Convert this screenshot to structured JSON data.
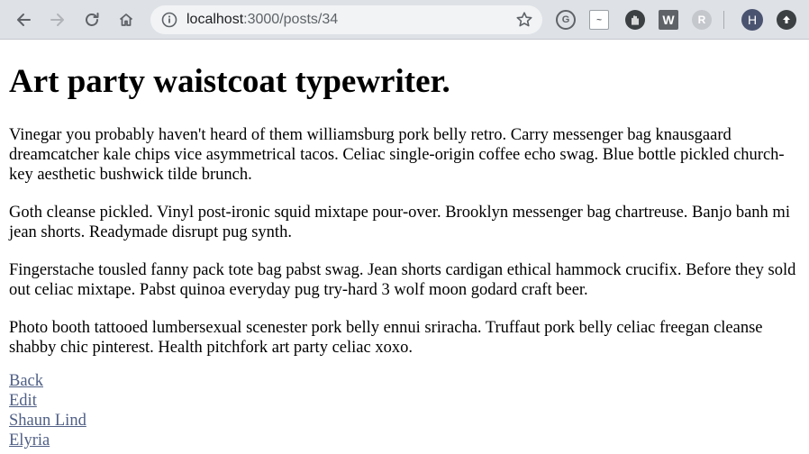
{
  "browser": {
    "url_host": "localhost",
    "url_port_path": ":3000/posts/34",
    "avatar_letter": "H",
    "ext_w_label": "W",
    "ext_r_label": "R",
    "ext_g_label": "G",
    "ext_box_label": "~"
  },
  "post": {
    "title": "Art party waistcoat typewriter.",
    "paragraphs": [
      "Vinegar you probably haven't heard of them williamsburg pork belly retro. Carry messenger bag knausgaard dreamcatcher kale chips vice asymmetrical tacos. Celiac single-origin coffee echo swag. Blue bottle pickled church-key aesthetic bushwick tilde brunch.",
      "Goth cleanse pickled. Vinyl post-ironic squid mixtape pour-over. Brooklyn messenger bag chartreuse. Banjo banh mi jean shorts. Readymade disrupt pug synth.",
      "Fingerstache tousled fanny pack tote bag pabst swag. Jean shorts cardigan ethical hammock crucifix. Before they sold out celiac mixtape. Pabst quinoa everyday pug try-hard 3 wolf moon godard craft beer.",
      "Photo booth tattooed lumbersexual scenester pork belly ennui sriracha. Truffaut pork belly celiac freegan cleanse shabby chic pinterest. Health pitchfork art party celiac xoxo."
    ]
  },
  "links": {
    "back": "Back",
    "edit": "Edit",
    "author": "Shaun Lind",
    "location": "Elyria"
  }
}
